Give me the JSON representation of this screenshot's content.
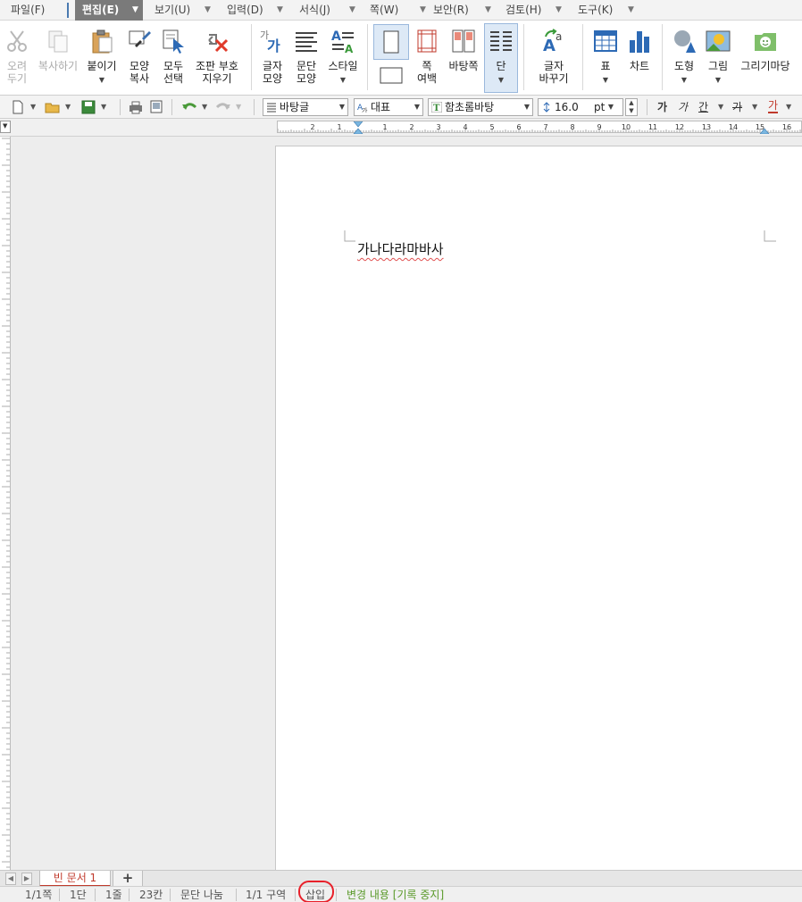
{
  "menu": {
    "items": [
      {
        "label": "파일(F)",
        "active": false
      },
      {
        "label": "편집(E)",
        "active": true
      },
      {
        "label": "보기(U)",
        "active": false
      },
      {
        "label": "입력(D)",
        "active": false
      },
      {
        "label": "서식(J)",
        "active": false
      },
      {
        "label": "쪽(W)",
        "active": false
      },
      {
        "label": "보안(R)",
        "active": false
      },
      {
        "label": "검토(H)",
        "active": false
      },
      {
        "label": "도구(K)",
        "active": false
      }
    ]
  },
  "ribbon": {
    "cut": {
      "label": "오려\n두기",
      "icon": "scissors-icon"
    },
    "copy": {
      "label": "복사하기",
      "icon": "copy-icon"
    },
    "paste": {
      "label": "붙이기",
      "icon": "clipboard-icon"
    },
    "format_copy": {
      "label": "모양\n복사",
      "icon": "format-painter-icon"
    },
    "select_all": {
      "label": "모두\n선택",
      "icon": "select-all-icon"
    },
    "delete_marks": {
      "label": "조판 부호\n지우기",
      "icon": "delete-marks-icon"
    },
    "char_shape": {
      "label": "글자\n모양",
      "icon": "char-shape-icon"
    },
    "para_shape": {
      "label": "문단\n모양",
      "icon": "para-shape-icon"
    },
    "style": {
      "label": "스타일",
      "icon": "style-icon"
    },
    "margin": {
      "label": "쪽\n여백",
      "icon": "page-margin-icon"
    },
    "master": {
      "label": "바탕쪽",
      "icon": "master-page-icon"
    },
    "column": {
      "label": "단",
      "icon": "columns-icon"
    },
    "replace": {
      "label": "글자\n바꾸기",
      "icon": "replace-text-icon"
    },
    "table": {
      "label": "표",
      "icon": "table-icon"
    },
    "chart": {
      "label": "차트",
      "icon": "chart-icon"
    },
    "shape": {
      "label": "도형",
      "icon": "shapes-icon"
    },
    "picture": {
      "label": "그림",
      "icon": "picture-icon"
    },
    "drawing": {
      "label": "그리기마당",
      "icon": "drawing-gallery-icon"
    }
  },
  "toolbar": {
    "style_value": "바탕글",
    "lang_value": "대표",
    "font_value": "함초롬바탕",
    "size_value": "16.0",
    "size_unit": "pt",
    "bold": "가",
    "italic": "가",
    "underline": "간",
    "strike": "가",
    "color": "가"
  },
  "ruler": {
    "h_ticks": [
      "2",
      "1",
      "1",
      "2",
      "3",
      "4",
      "5",
      "6",
      "7",
      "8",
      "9",
      "10",
      "11",
      "12",
      "13",
      "14",
      "15",
      "16"
    ]
  },
  "document": {
    "text": "가나다라마바사"
  },
  "tabs": {
    "doc_tab": "빈 문서 1",
    "add": "+"
  },
  "status": {
    "page": "1/1쪽",
    "column": "1단",
    "line": "1줄",
    "col": "23칸",
    "break": "문단 나눔",
    "section": "1/1 구역",
    "mode": "삽입",
    "track": "변경 내용 [기록 중지]"
  },
  "colors": {
    "accent": "#4a7ab0",
    "status_green": "#5a9a2a",
    "tab_red": "#c0392b",
    "highlight_ring": "#e8202a"
  }
}
